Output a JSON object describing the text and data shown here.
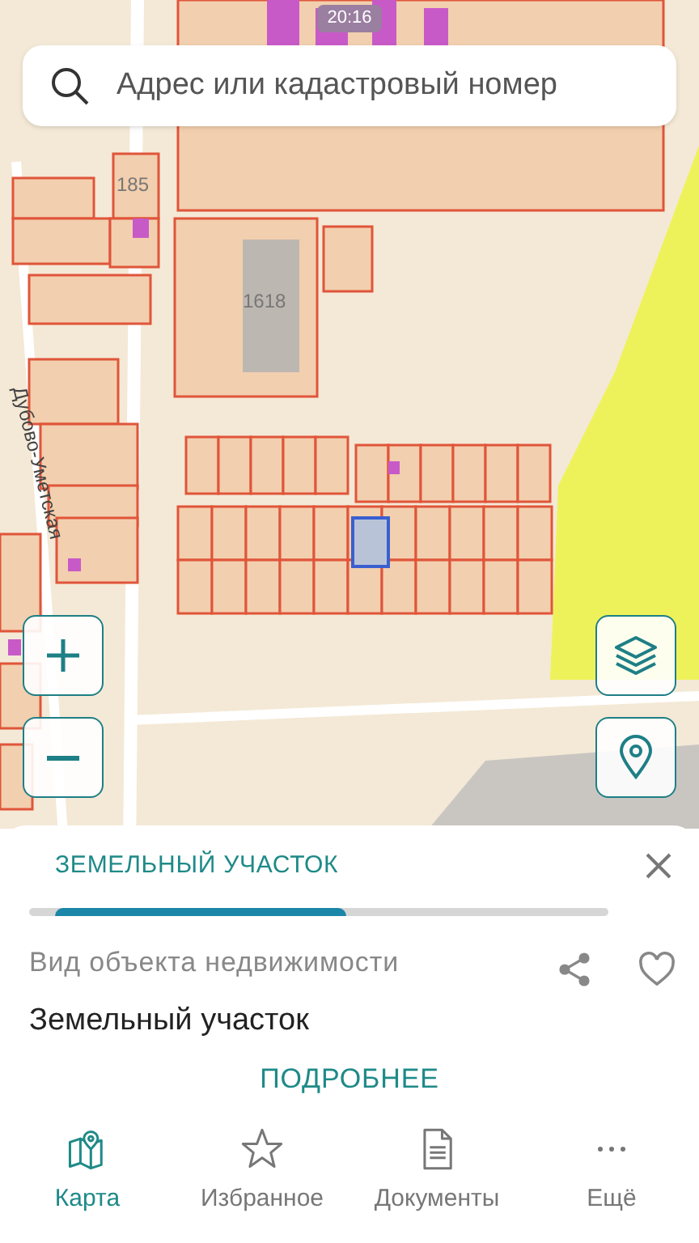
{
  "status_bar": {
    "time": "20:16"
  },
  "search": {
    "placeholder": "Адрес или кадастровый номер"
  },
  "map": {
    "labels": [
      {
        "text": "185",
        "kind": "number"
      },
      {
        "text": "1618",
        "kind": "number"
      },
      {
        "text": "Дубово-Уметская",
        "kind": "street"
      }
    ]
  },
  "sheet": {
    "tabs": [
      {
        "label": "ЗЕМЕЛЬНЫЙ УЧАСТОК",
        "selected": true
      }
    ],
    "fields": [
      {
        "label": "Вид объекта недвижимости",
        "value": "Земельный участок"
      }
    ],
    "more_button": "ПОДРОБНЕЕ"
  },
  "tab_bar": [
    {
      "label": "Карта",
      "kind": "map",
      "selected": true
    },
    {
      "label": "Избранное",
      "kind": "star",
      "selected": false
    },
    {
      "label": "Документы",
      "kind": "document",
      "selected": false
    },
    {
      "label": "Ещё",
      "kind": "more",
      "selected": false
    }
  ]
}
